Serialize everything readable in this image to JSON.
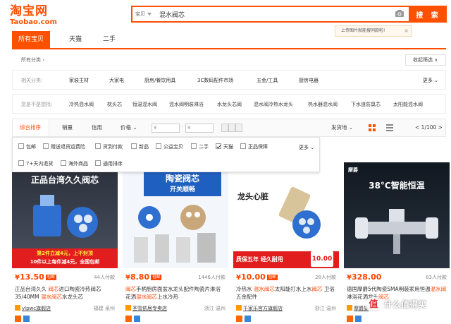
{
  "logo": {
    "cn": "淘宝网",
    "en": "Taobao.com"
  },
  "search": {
    "scope": "宝贝",
    "query": "混水阀芯",
    "button": "搜 索",
    "tip": "上传图片就能搜同款啦!",
    "tip_close": "×"
  },
  "tabs": [
    "所有宝贝",
    "天猫",
    "二手"
  ],
  "crumb": "所有分类 ›",
  "collapse": "收起筛选 ∧",
  "related_categories": {
    "label": "相关分类:",
    "items": [
      "家装主材",
      "大家电",
      "厨房/餐饮用具",
      "3C数码配件市场",
      "五金/工具",
      "厨房电器"
    ],
    "more": "更多 ⌄"
  },
  "related_search": {
    "label": "您是不是想找:",
    "items": [
      "冷热混水阀",
      "枕头芯",
      "恒温混水阀",
      "混水阀明装淋浴",
      "水龙头芯阀",
      "混水阀冷热水龙头",
      "热水器混水阀",
      "下水道防臭芯",
      "太阳能混水阀"
    ]
  },
  "sort": {
    "items": [
      "综合排序",
      "销量",
      "信用",
      "价格 ⌄"
    ],
    "price_from": "¥",
    "dash": "-",
    "price_to": "¥",
    "ship": "发货地 ⌄",
    "pager": "< 1/100 >"
  },
  "filters": {
    "row1": [
      {
        "label": "包邮",
        "checked": false
      },
      {
        "label": "赠送退货运费险",
        "checked": false
      },
      {
        "label": "货到付款",
        "checked": false
      },
      {
        "label": "新品",
        "checked": false
      },
      {
        "label": "公益宝贝",
        "checked": false
      },
      {
        "label": "二手",
        "checked": false
      },
      {
        "label": "天猫",
        "checked": true
      },
      {
        "label": "正品保障",
        "checked": false
      }
    ],
    "row2": [
      {
        "label": "7+天内退货",
        "checked": false
      },
      {
        "label": "海外商品",
        "checked": false
      },
      {
        "label": "通用排序",
        "checked": false
      }
    ],
    "more": "更多 ⌄"
  },
  "products": [
    {
      "price": "13.50",
      "yen": "¥",
      "bao": "包邮",
      "paid": "44人付款",
      "title_pre": "正品台湾久久 ",
      "title_hl": "阀芯",
      "title_post": "进口陶瓷冷热阀芯35/40MM ",
      "title_hl2": "混水阀芯",
      "title_end": "水龙头芯",
      "shop": "ylpwc旗舰店",
      "loc": "福建 泉州",
      "img_title": "正品台湾久久阀芯",
      "img_sub": "第2件立减4元，上不封顶",
      "img_sub2": "10件以上每件减4元，全国包邮"
    },
    {
      "price": "8.80",
      "yen": "¥",
      "bao": "包邮",
      "paid": "1446人付款",
      "title_pre": "",
      "title_hl": "阀芯",
      "title_post": "手柄厨房面盆水龙头配件陶瓷片淋浴花洒",
      "title_hl2": "混水阀芯",
      "title_end": "上水冷热",
      "shop": "圣雪依居专卖店",
      "loc": "浙江 温州",
      "img_title": "陶瓷阀芯",
      "img_sub": "开关顺畅",
      "img_sub2": ""
    },
    {
      "price": "10.00",
      "yen": "¥",
      "bao": "包邮",
      "paid": "28人付款",
      "title_pre": "冷热水 ",
      "title_hl": "混水阀芯",
      "title_post": "太阳能打水上水",
      "title_hl2": "阀芯",
      "title_end": " 卫浴五金配件",
      "shop": "千家乐官方旗舰店",
      "loc": "浙江 温州",
      "img_title": "龙头心脏",
      "img_sub": "质保五年 经久耐用",
      "img_sub2": "10.00"
    },
    {
      "price": "328.00",
      "yen": "¥",
      "bao": "",
      "paid": "83人付款",
      "title_pre": "德国摩爵5代陶瓷SMA明装家用恒温",
      "title_hl": "混水阀",
      "title_post": "淋浴花洒龙头",
      "title_hl2": "阀芯",
      "title_end": "",
      "shop": "摩爵旗舰店",
      "loc": "",
      "img_title": "38°C智能恒温",
      "img_sub": "摩爵",
      "img_sub2": ""
    }
  ],
  "watermark": {
    "icon": "值",
    "text": "什么值得买"
  },
  "colors": {
    "brand": "#ff5000",
    "price": "#ff4400"
  }
}
